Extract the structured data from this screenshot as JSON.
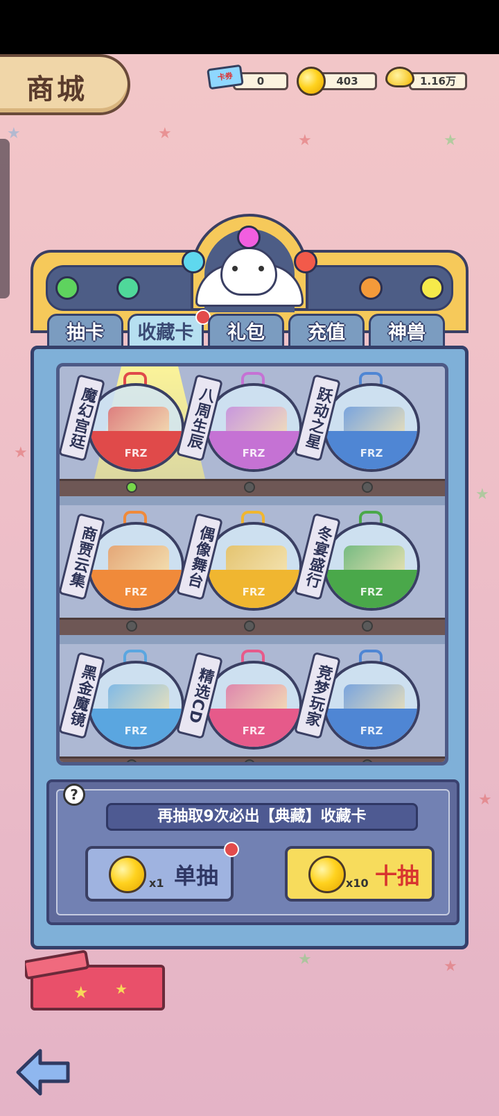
{
  "header": {
    "title": "商城"
  },
  "currencies": {
    "ticket": {
      "icon": "ticket-icon",
      "label": "卡券",
      "value": "0"
    },
    "coin": {
      "icon": "gold-coin-icon",
      "value": "403"
    },
    "ingot": {
      "icon": "gold-ingot-icon",
      "value": "1.16万"
    }
  },
  "tabs": [
    {
      "label": "抽卡",
      "active": false
    },
    {
      "label": "收藏卡",
      "active": true,
      "badge": true
    },
    {
      "label": "礼包",
      "active": false
    },
    {
      "label": "充值",
      "active": false
    },
    {
      "label": "神兽",
      "active": false
    }
  ],
  "capsules": [
    {
      "label": "魔幻宫廷",
      "brand": "FRZ",
      "color": "#e04a4a",
      "selected": true
    },
    {
      "label": "八周生辰",
      "brand": "FRZ",
      "color": "#c572d4",
      "selected": false
    },
    {
      "label": "跃动之星",
      "brand": "FRZ",
      "color": "#4f86d4",
      "selected": false
    },
    {
      "label": "商贾云集",
      "brand": "FRZ",
      "color": "#f08a3a",
      "selected": false
    },
    {
      "label": "偶像舞台",
      "brand": "FRZ",
      "color": "#f0b630",
      "selected": false
    },
    {
      "label": "冬宴盛行",
      "brand": "FRZ",
      "color": "#4aa84a",
      "selected": false
    },
    {
      "label": "黑金魔镜",
      "brand": "FRZ",
      "color": "#5aa6e0",
      "selected": false
    },
    {
      "label": "精选CD",
      "brand": "FRZ",
      "color": "#e65a8a",
      "selected": false
    },
    {
      "label": "竞梦玩家",
      "brand": "FRZ",
      "color": "#4f86d4",
      "selected": false
    }
  ],
  "draw_panel": {
    "help_label": "?",
    "notice": "再抽取9次必出【典藏】收藏卡",
    "single": {
      "multiplier": "x1",
      "label": "单抽",
      "badge": true
    },
    "ten": {
      "multiplier": "x10",
      "label": "十抽"
    }
  },
  "colors": {
    "accent_gold": "#f6c95a",
    "panel_blue": "#5f6a9b",
    "ten_button": "#f7dc5c",
    "single_button": "#9fb3e0",
    "highlight_red": "#d8352f"
  }
}
